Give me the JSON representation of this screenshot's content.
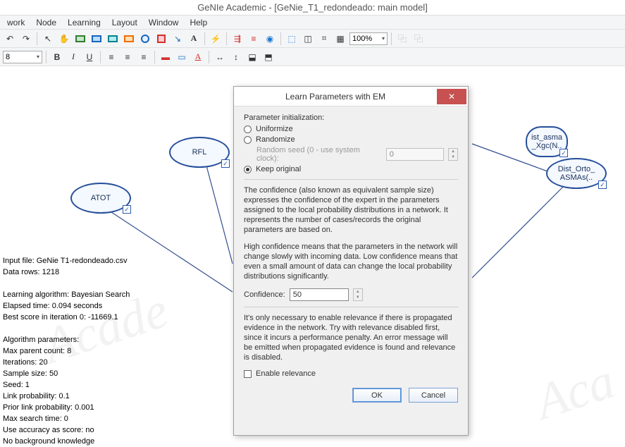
{
  "title": "GeNIe Academic - [GeNie_T1_redondeado: main model]",
  "menu": [
    "work",
    "Node",
    "Learning",
    "Layout",
    "Window",
    "Help"
  ],
  "zoom": "100%",
  "font_size": "8",
  "nodes": {
    "rfl": "RFL",
    "atot": "ATOT",
    "ist_asma": "ist_asma\n_Xgc(N..",
    "dist_orto": "Dist_Orto_\nASMAs(.."
  },
  "watermark1": "Acade",
  "watermark2": "Aca",
  "info": {
    "l1": "Input file: GeNie T1-redondeado.csv",
    "l2": "Data rows: 1218",
    "l3": "Learning algorithm: Bayesian Search",
    "l4": "Elapsed time: 0.094 seconds",
    "l5": "Best score in iteration 0: -11669.1",
    "l6": "Algorithm parameters:",
    "l7": "Max parent count: 8",
    "l8": "Iterations: 20",
    "l9": "Sample size: 50",
    "l10": "Seed: 1",
    "l11": "Link probability: 0.1",
    "l12": "Prior link probability: 0.001",
    "l13": "Max search time: 0",
    "l14": "Use accuracy as score: no",
    "l15": "No background knowledge"
  },
  "dialog": {
    "title": "Learn Parameters with EM",
    "param_init_label": "Parameter initialization:",
    "opt_uniformize": "Uniformize",
    "opt_randomize": "Randomize",
    "seed_label": "Random seed (0 - use system clock):",
    "seed_value": "0",
    "opt_keep": "Keep original",
    "confidence_text1": "The confidence (also known as equivalent sample size) expresses the confidence of the expert in the parameters assigned to the local probability distributions in a network. It represents the number of cases/records the original parameters are based on.",
    "confidence_text2": "High confidence means that the parameters in the network will change slowly with incoming data. Low confidence means that even a small amount of data can change the local probability distributions significantly.",
    "confidence_label": "Confidence:",
    "confidence_value": "50",
    "relevance_text": "It's only necessary to enable relevance if there is propagated evidence in the network. Try with relevance disabled first, since it incurs a performance penalty. An error message will be emitted when propagated evidence is found and relevance is disabled.",
    "enable_relevance": "Enable relevance",
    "btn_ok": "OK",
    "btn_cancel": "Cancel"
  },
  "toolbar_icons1": [
    "↶",
    "↷",
    "✋",
    "arrow",
    "rect-green",
    "rect-blue",
    "rect-teal",
    "rect-orange",
    "circle",
    "square",
    "gear",
    "text",
    "bolt",
    "sep",
    "tree1",
    "tree2",
    "target",
    "sep",
    "grp1",
    "grp2",
    "grp3",
    "grid",
    "zoomctl",
    "sep",
    "z-",
    "z+"
  ],
  "toolbar_icons2": [
    "B",
    "I",
    "U",
    "|",
    "align-l",
    "align-c",
    "align-r",
    "|",
    "fill",
    "line",
    "font",
    "|",
    "tool-a",
    "tool-b",
    "tool-c",
    "tool-d",
    "|",
    "copy1",
    "copy2"
  ]
}
